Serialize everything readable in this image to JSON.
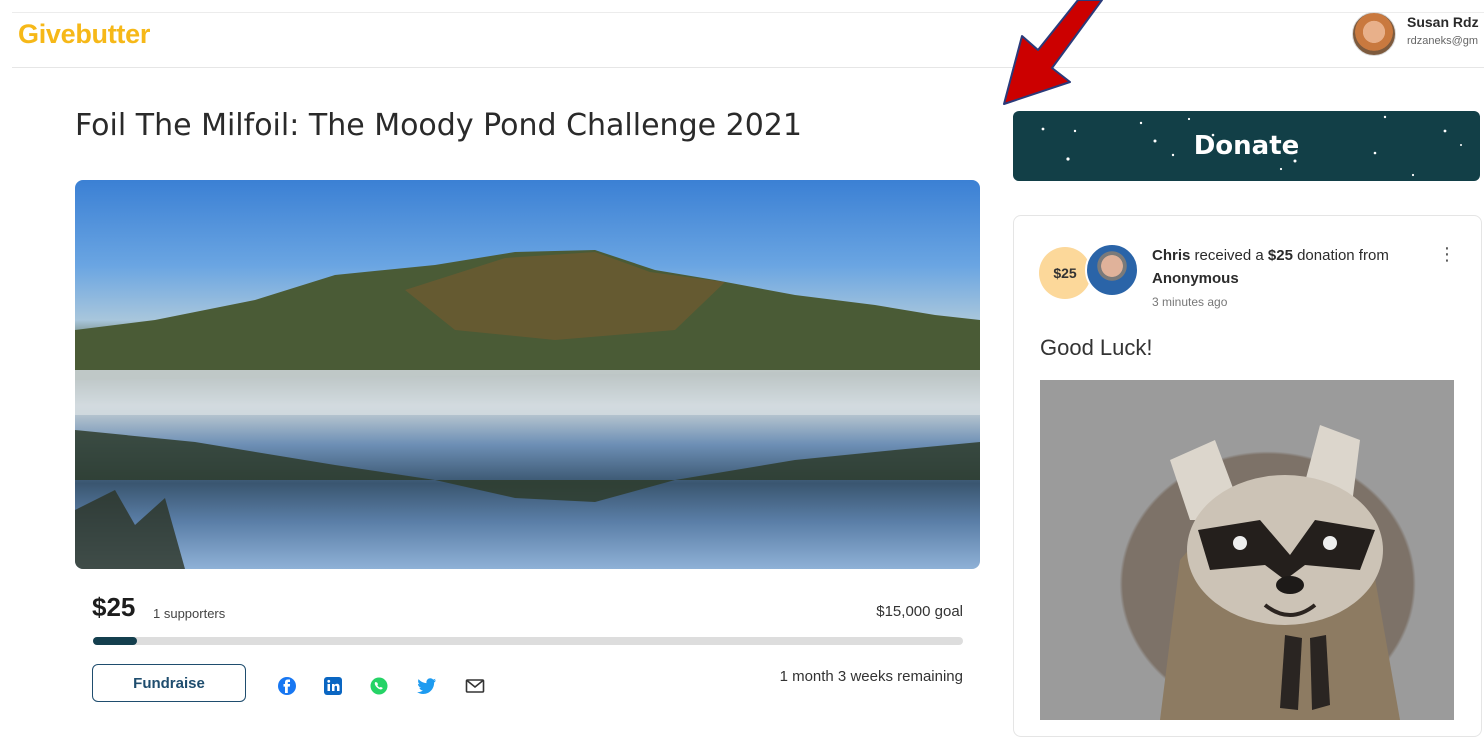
{
  "header": {
    "logo_text": "Givebutter",
    "user_name": "Susan Rdz",
    "user_email": "rdzaneks@gm"
  },
  "campaign": {
    "title": "Foil The Milfoil: The Moody Pond Challenge 2021",
    "amount_raised": "$25",
    "supporters_text": "1 supporters",
    "goal_text": "$15,000 goal",
    "progress_fraction": 0.05,
    "time_remaining": "1 month 3 weeks remaining",
    "fundraise_label": "Fundraise",
    "share_icons": [
      "facebook-icon",
      "linkedin-icon",
      "whatsapp-icon",
      "twitter-icon",
      "email-icon"
    ]
  },
  "donate": {
    "label": "Donate"
  },
  "activity": {
    "amount_badge": "$25",
    "recipient": "Chris",
    "text_middle": " received a ",
    "amount": "$25",
    "text_after": " donation from",
    "donor": "Anonymous",
    "time": "3 minutes ago",
    "message": "Good Luck!"
  },
  "colors": {
    "brand_yellow": "#f6b818",
    "donate_bg": "#123f47",
    "progress_fill": "#143f4e",
    "accent_border": "#1f4d6e",
    "arrow_red": "#cc0000"
  }
}
